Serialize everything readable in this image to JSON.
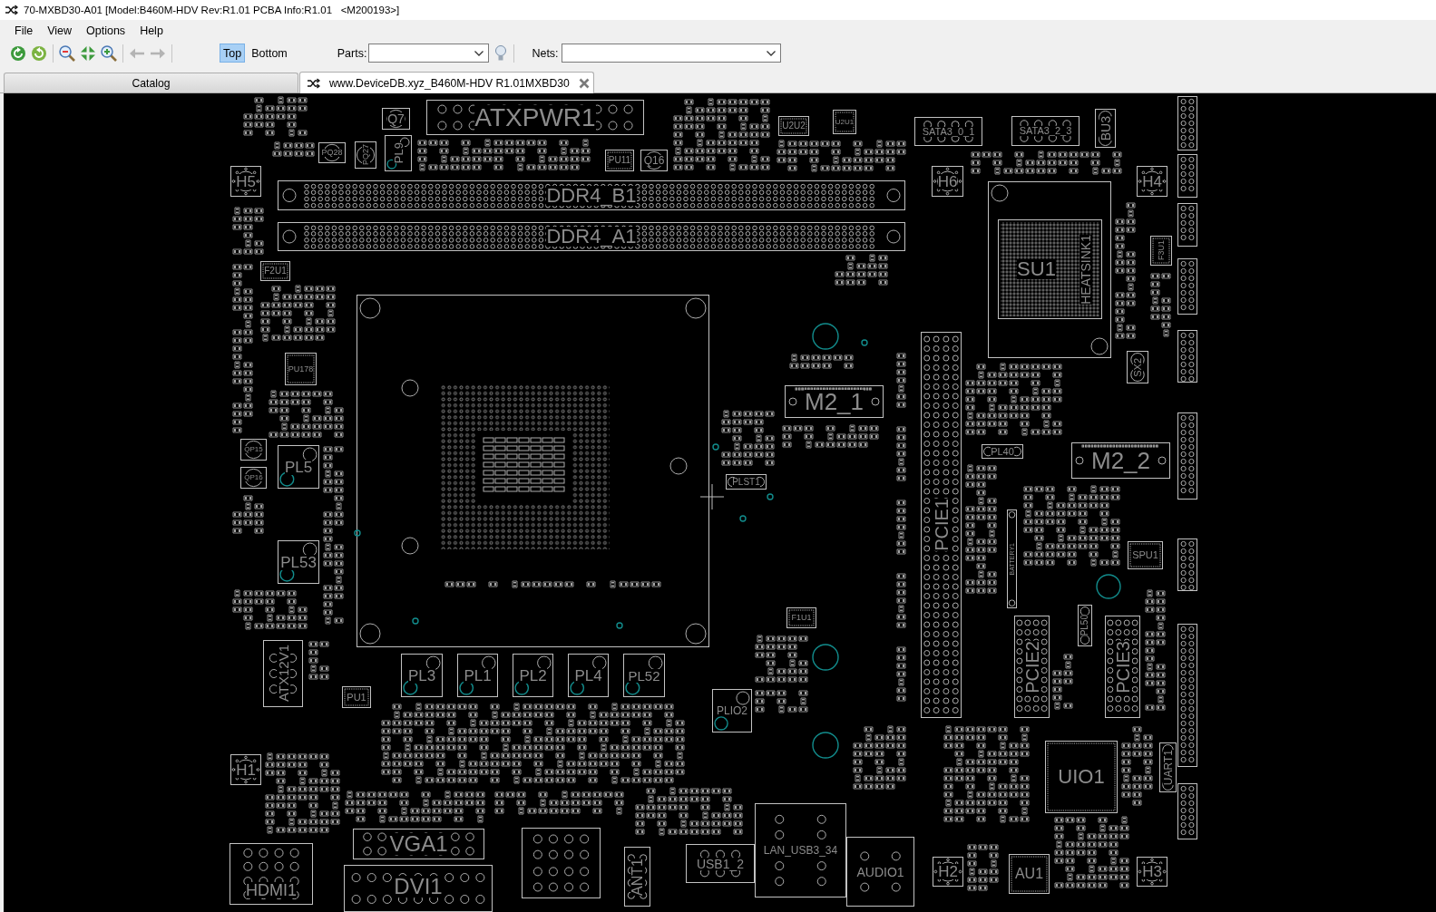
{
  "window": {
    "title": "70-MXBD30-A01 [Model:B460M-HDV Rev:R1.01 PCBA Info:R1.01   <M200193>]"
  },
  "menu": [
    "File",
    "View",
    "Options",
    "Help"
  ],
  "toolbar": {
    "buttons": [
      {
        "kind": "refresh",
        "disabled": false
      },
      {
        "kind": "reload",
        "disabled": false
      },
      {
        "kind": "zoom-out",
        "disabled": false
      },
      {
        "kind": "fit",
        "disabled": false
      },
      {
        "kind": "zoom-in",
        "disabled": false
      },
      {
        "kind": "back",
        "disabled": true
      },
      {
        "kind": "forward",
        "disabled": true
      }
    ],
    "layers": [
      {
        "label": "Top",
        "selected": true
      },
      {
        "label": "Bottom",
        "selected": false
      }
    ],
    "parts": {
      "label": "Parts:"
    },
    "nets": {
      "label": "Nets:"
    }
  },
  "tabs": [
    {
      "label": "Catalog",
      "kind": "catalog",
      "selected": false
    },
    {
      "label": "www.DeviceDB.xyz_B460M-HDV R1.01MXBD30",
      "kind": "document",
      "selected": true
    }
  ],
  "board": {
    "components": [
      {
        "kind": "connector",
        "label": "ATXPWR1"
      },
      {
        "kind": "chip",
        "label": "U2U2"
      },
      {
        "kind": "chip",
        "label": "U2U1"
      },
      {
        "kind": "connector",
        "label": "SATA3_0_1"
      },
      {
        "kind": "connector",
        "label": "SATA3_2_3"
      },
      {
        "kind": "header",
        "label": "BU3"
      },
      {
        "kind": "round",
        "label": "Q7"
      },
      {
        "kind": "round",
        "label": "PQ28"
      },
      {
        "kind": "round",
        "label": "PQ27"
      },
      {
        "kind": "inductor",
        "label": "PL9"
      },
      {
        "kind": "chip",
        "label": "PU11"
      },
      {
        "kind": "round",
        "label": "Q16"
      },
      {
        "kind": "hole",
        "label": "H5"
      },
      {
        "kind": "hole",
        "label": "H6"
      },
      {
        "kind": "hole",
        "label": "H4"
      },
      {
        "kind": "slot",
        "label": "DDR4_B1"
      },
      {
        "kind": "slot",
        "label": "DDR4_A1"
      },
      {
        "kind": "heatsink",
        "label": "HEATSINK1"
      },
      {
        "kind": "bga",
        "label": "SU1"
      },
      {
        "kind": "chip",
        "label": "F3U1"
      },
      {
        "kind": "chip",
        "label": "F2U1"
      },
      {
        "kind": "socket"
      },
      {
        "kind": "chip",
        "label": "PU178"
      },
      {
        "kind": "header",
        "label": "SX2"
      },
      {
        "kind": "pcie",
        "label": "PCIE1"
      },
      {
        "kind": "m2",
        "label": "M2_1"
      },
      {
        "kind": "round",
        "label": "QP15"
      },
      {
        "kind": "inductor",
        "label": "PL5"
      },
      {
        "kind": "header",
        "label": "PL40"
      },
      {
        "kind": "m2",
        "label": "M2_2"
      },
      {
        "kind": "round",
        "label": "QP16"
      },
      {
        "kind": "header",
        "label": "PLST1"
      },
      {
        "kind": "header",
        "label": "BATTERY1"
      },
      {
        "kind": "chip",
        "label": "SPU1"
      },
      {
        "kind": "inductor",
        "label": "PL53"
      },
      {
        "kind": "chip",
        "label": "F1U1"
      },
      {
        "kind": "header",
        "label": "PL50"
      },
      {
        "kind": "pcie",
        "label": "PCIE2"
      },
      {
        "kind": "pcie",
        "label": "PCIE3"
      },
      {
        "kind": "connector",
        "label": "ATX12V1"
      },
      {
        "kind": "inductor",
        "label": "PL3"
      },
      {
        "kind": "inductor",
        "label": "PL1"
      },
      {
        "kind": "inductor",
        "label": "PL2"
      },
      {
        "kind": "inductor",
        "label": "PL4"
      },
      {
        "kind": "inductor",
        "label": "PL52"
      },
      {
        "kind": "chip",
        "label": "PU1"
      },
      {
        "kind": "inductor",
        "label": "PLIO2"
      },
      {
        "kind": "chip",
        "label": "UIO1"
      },
      {
        "kind": "header",
        "label": "UART1"
      },
      {
        "kind": "hole",
        "label": "H1"
      },
      {
        "kind": "connector",
        "label": "LAN_USB3_34"
      },
      {
        "kind": "connector",
        "label": "VGA1"
      },
      {
        "kind": "connector"
      },
      {
        "kind": "connector",
        "label": "AUDIO1"
      },
      {
        "kind": "connector",
        "label": "HDMI1"
      },
      {
        "kind": "connector",
        "label": "USB1_2"
      },
      {
        "kind": "connector",
        "label": "ANT1"
      },
      {
        "kind": "hole",
        "label": "H2"
      },
      {
        "kind": "chip",
        "label": "AU1"
      },
      {
        "kind": "hole",
        "label": "H3"
      },
      {
        "kind": "connector",
        "label": "DVI1"
      }
    ]
  }
}
